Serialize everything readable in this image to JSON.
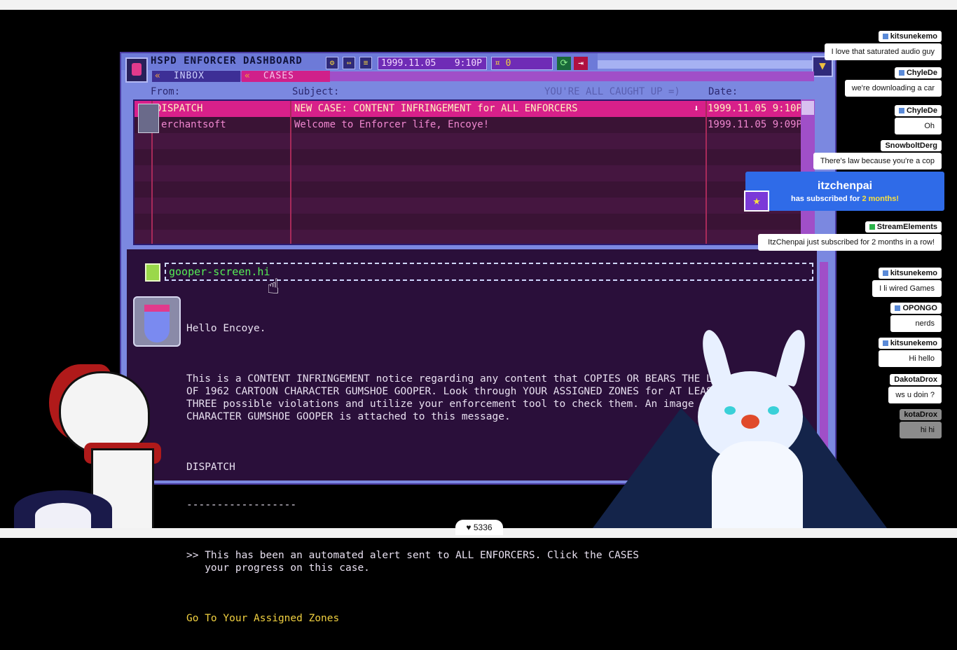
{
  "window": {
    "title": "HSPD ENFORCER DASHBOARD",
    "date": "1999.11.05",
    "time": "9:10P",
    "coins": "0",
    "tabs": {
      "inbox": "INBOX",
      "cases": "CASES"
    }
  },
  "list_headers": {
    "from": "From:",
    "subject": "Subject:",
    "status": "YOU'RE ALL CAUGHT UP =)",
    "date": "Date:"
  },
  "messages": [
    {
      "from": "DISPATCH",
      "subject": "NEW CASE: CONTENT INFRINGEMENT for ALL ENFORCERS",
      "date": "1999.11.05 9:10P"
    },
    {
      "from": "erchantsoft",
      "subject": "Welcome to Enforcer life, Encoye!",
      "date": "1999.11.05 9:09P"
    }
  ],
  "viewer": {
    "attachment": "gooper-screen.hi",
    "greeting": "Hello Encoye.",
    "body": "This is a CONTENT INFRINGEMENT notice regarding any content that COPIES OR BEARS THE LIKENESS\nOF 1962 CARTOON CHARACTER GUMSHOE GOOPER. Look through YOUR ASSIGNED ZONES for AT LEAST\nTHREE possible violations and utilize your enforcement tool to check them. An image of\nCHARACTER GUMSHOE GOOPER is attached to this message.",
    "signature": "DISPATCH",
    "separator": "------------------",
    "note": ">> This has been an automated alert sent to ALL ENFORCERS. Click the CASES\n   your progress on this case.",
    "link": "Go To Your Assigned Zones"
  },
  "chat": [
    {
      "name": "kitsunekemo",
      "text": "I love that saturated audio guy"
    },
    {
      "name": "ChyleDe",
      "text": "we're downloading a car"
    },
    {
      "name": "ChyleDe",
      "text": "Oh"
    },
    {
      "name": "SnowboltDerg",
      "text": "There's law because you're a cop"
    },
    {
      "name": "StreamElements",
      "text": "ItzChenpai just subscribed for 2 months in a row!"
    },
    {
      "name": "kitsunekemo",
      "text": "I li wired Games"
    },
    {
      "name": "OPONGO",
      "text": "nerds"
    },
    {
      "name": "kitsunekemo",
      "text": "Hi hello"
    },
    {
      "name": "DakotaDrox",
      "text": "ws u doin ?"
    },
    {
      "name": "kotaDrox",
      "text": "hi hi"
    }
  ],
  "sub_alert": {
    "name": "itzchenpai",
    "text_pre": "has subscribed for ",
    "months": "2 months!"
  },
  "likes": "5336",
  "colors": {
    "window_bg": "#7b88e0",
    "list_bg": "#3a1335",
    "selected_row": "#d8208a",
    "text_link": "#f0d040",
    "attachment_text": "#55ee55",
    "sub_alert_bg": "#2f6be8"
  },
  "icons": [
    "settings-icon",
    "split-icon",
    "menu-icon",
    "coin-icon",
    "refresh-icon",
    "logout-icon",
    "collapse-icon",
    "download-icon",
    "file-icon",
    "cursor-icon",
    "heart-icon"
  ]
}
